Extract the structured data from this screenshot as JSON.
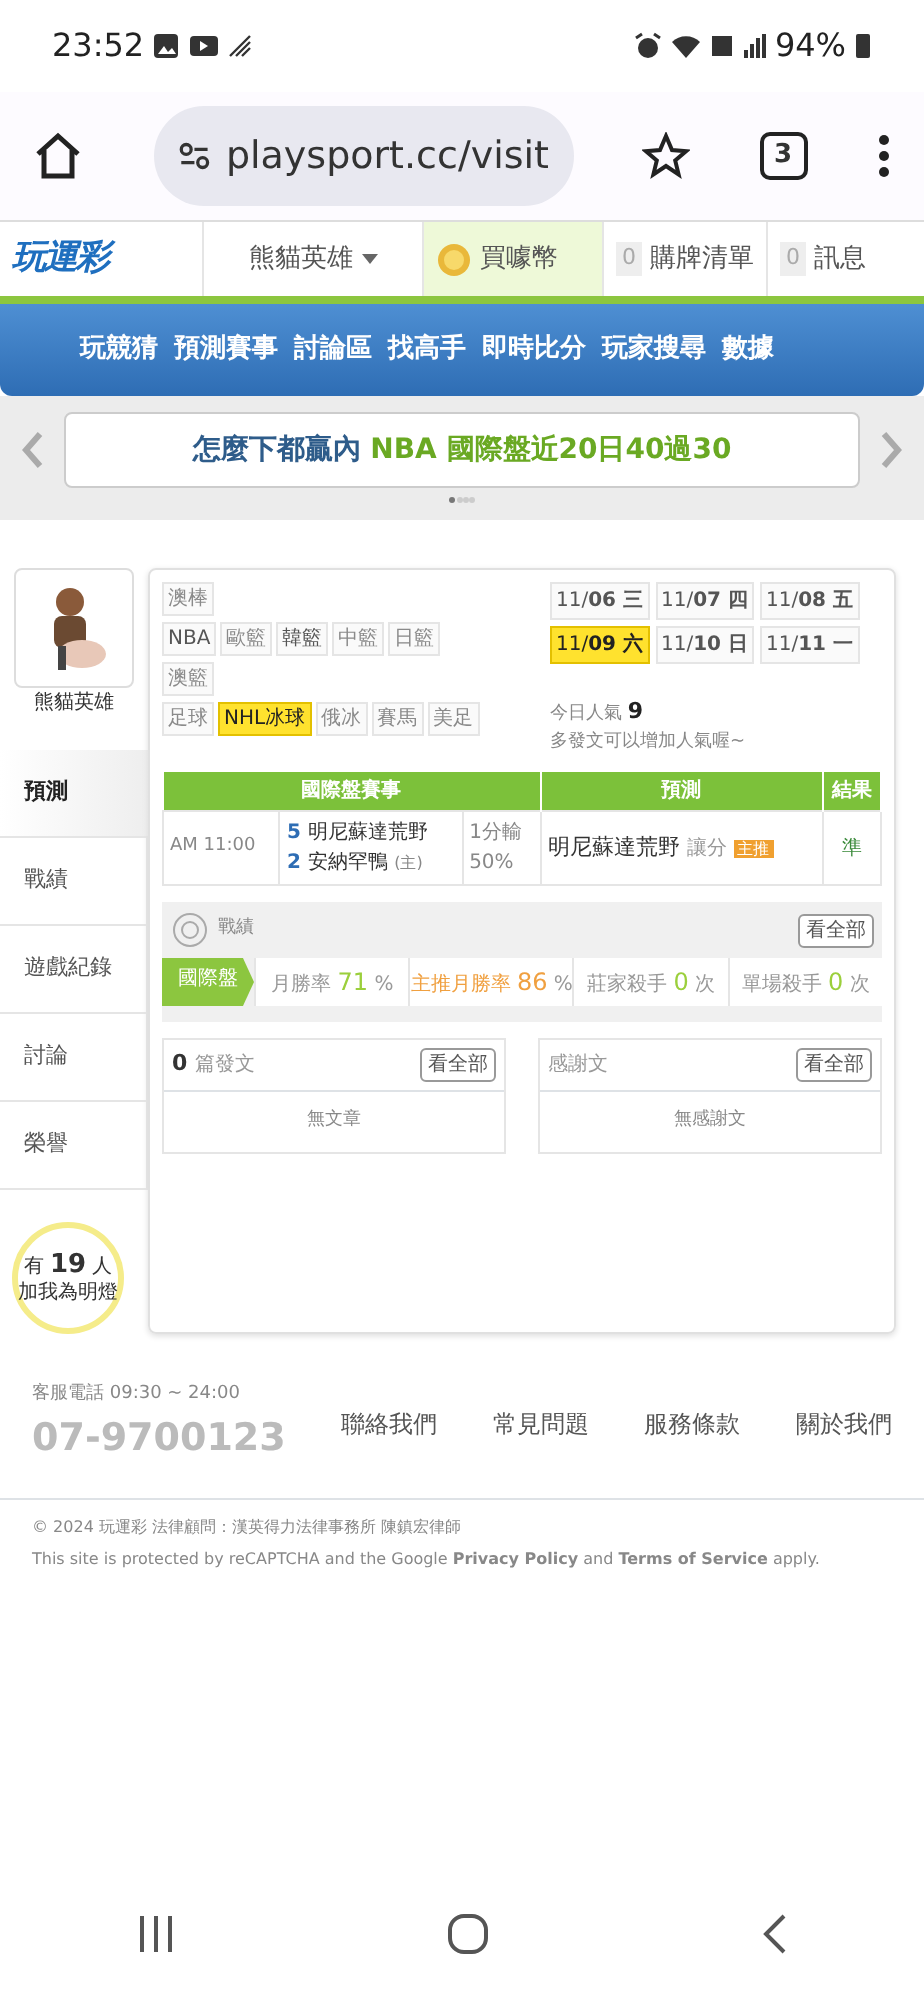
{
  "status_bar": {
    "time": "23:52",
    "battery": "94%"
  },
  "browser": {
    "url": "playsport.cc/visit",
    "tab_count": "3"
  },
  "topbar": {
    "logo": "玩運彩",
    "user": "熊貓英雄",
    "buy": "買噱幣",
    "cart_count": "0",
    "cart": "購牌清單",
    "msg_count": "0",
    "msg": "訊息"
  },
  "main_nav": [
    "玩競猜",
    "預測賽事",
    "討論區",
    "找高手",
    "即時比分",
    "玩家搜尋",
    "數據"
  ],
  "banner": {
    "prefix": "怎麼下都贏內",
    "highlight": "NBA 國際盤近20日40過30"
  },
  "profile": {
    "name": "熊貓英雄",
    "fans_prefix": "有",
    "fans_count": "19",
    "fans_suffix": "人",
    "fans_note": "加我為明燈"
  },
  "side_menu": [
    {
      "label": "預測",
      "selected": true
    },
    {
      "label": "戰績",
      "selected": false
    },
    {
      "label": "遊戲紀錄",
      "selected": false
    },
    {
      "label": "討論",
      "selected": false
    },
    {
      "label": "榮譽",
      "selected": false
    }
  ],
  "sports": [
    [
      {
        "label": "澳棒",
        "disabled": true,
        "selected": false
      }
    ],
    [
      {
        "label": "NBA",
        "disabled": false,
        "selected": false
      },
      {
        "label": "歐籃",
        "disabled": true,
        "selected": false
      },
      {
        "label": "韓籃",
        "disabled": false,
        "selected": false
      },
      {
        "label": "中籃",
        "disabled": true,
        "selected": false
      },
      {
        "label": "日籃",
        "disabled": true,
        "selected": false
      }
    ],
    [
      {
        "label": "澳籃",
        "disabled": true,
        "selected": false
      }
    ],
    [
      {
        "label": "足球",
        "disabled": true,
        "selected": false
      },
      {
        "label": "NHL冰球",
        "disabled": false,
        "selected": true
      },
      {
        "label": "俄冰",
        "disabled": true,
        "selected": false
      },
      {
        "label": "賽馬",
        "disabled": true,
        "selected": false
      },
      {
        "label": "美足",
        "disabled": true,
        "selected": false
      }
    ]
  ],
  "dates": [
    {
      "month": "11/",
      "day": "06 三",
      "selected": false
    },
    {
      "month": "11/",
      "day": "07 四",
      "selected": false
    },
    {
      "month": "11/",
      "day": "08 五",
      "selected": false
    },
    {
      "month": "11/",
      "day": "09 六",
      "selected": true
    },
    {
      "month": "11/",
      "day": "10 日",
      "selected": false
    },
    {
      "month": "11/",
      "day": "11 一",
      "selected": false
    }
  ],
  "popularity": {
    "label": "今日人氣",
    "value": "9",
    "hint": "多發文可以增加人氣喔~"
  },
  "games_table": {
    "columns": [
      "國際盤賽事",
      "預測",
      "結果"
    ],
    "rows": [
      {
        "time": "AM 11:00",
        "away_num": "5",
        "away": "明尼蘇達荒野",
        "home_num": "2",
        "home": "安納罕鴨",
        "home_mark": "(主)",
        "line": "1分輸",
        "pct": "50%",
        "pick": "明尼蘇達荒野",
        "pick_type": "讓分",
        "tag": "主推",
        "result": "準"
      }
    ]
  },
  "record": {
    "title": "戰績",
    "view_all": "看全部",
    "category": "國際盤",
    "stats": [
      {
        "label": "月勝率",
        "value": "71",
        "unit": "%",
        "kind": "green"
      },
      {
        "label": "主推月勝率",
        "value": "86",
        "unit": "%",
        "kind": "orange"
      },
      {
        "label": "莊家殺手",
        "value": "0",
        "unit": "次",
        "kind": "green"
      },
      {
        "label": "單場殺手",
        "value": "0",
        "unit": "次",
        "kind": "green"
      }
    ]
  },
  "posts": [
    {
      "count": "0",
      "title": "篇發文",
      "view_all": "看全部",
      "empty": "無文章"
    },
    {
      "title": "感謝文",
      "view_all": "看全部",
      "empty": "無感謝文"
    }
  ],
  "footer": {
    "phone_label": "客服電話 09:30 ~ 24:00",
    "phone": "07-9700123",
    "links": [
      "聯絡我們",
      "常見問題",
      "服務條款",
      "關於我們"
    ],
    "copyright": "© 2024 玩運彩 法律顧問：漢英得力法律事務所 陳鎮宏律師",
    "recaptcha": "This site is protected by reCAPTCHA and the Google **Privacy Policy** and **Terms of Service** apply."
  }
}
